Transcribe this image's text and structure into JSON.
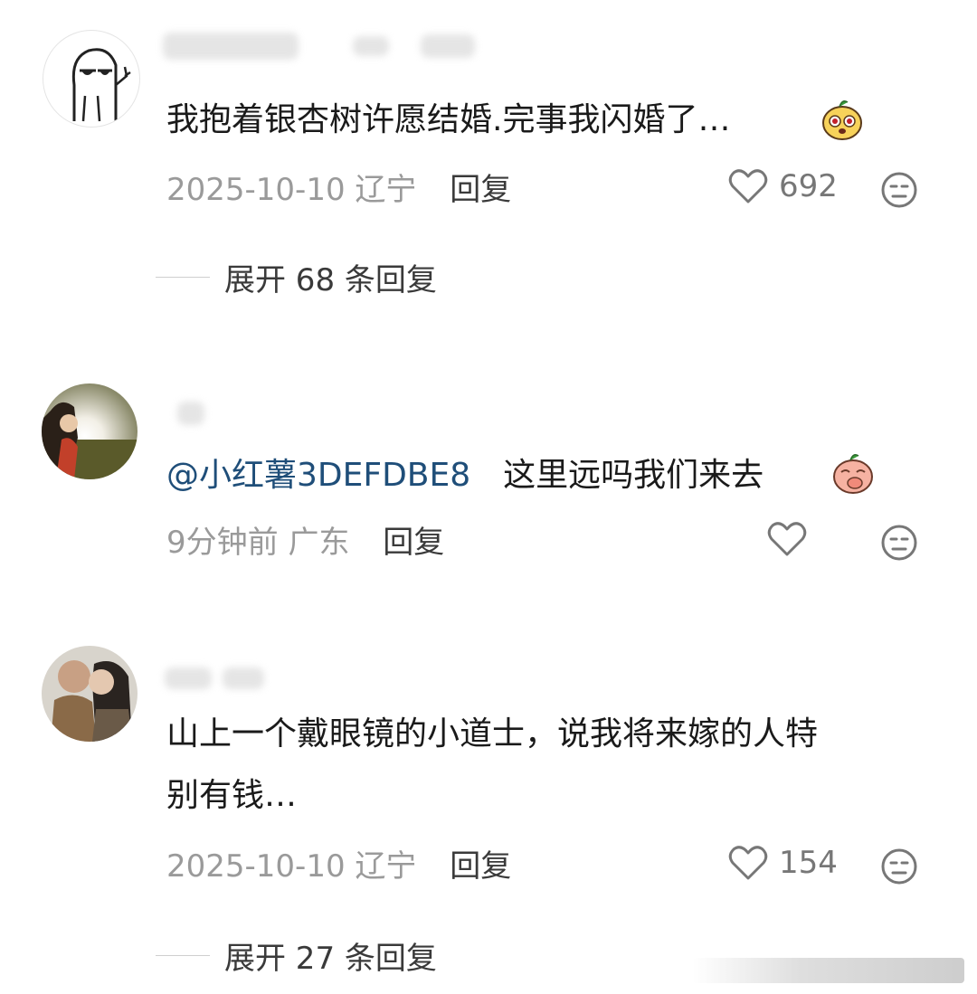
{
  "colors": {
    "mention": "#1f4e79",
    "meta_text": "#9a9a9a",
    "body_text": "#1a1a1a",
    "icon_grey": "#777777"
  },
  "comments": [
    {
      "text": "我抱着银杏树许愿结婚.完事我闪婚了…",
      "emoji": "peach-face-shocked",
      "date": "2025-10-10",
      "location": "辽宁",
      "reply_label": "回复",
      "likes": "692",
      "like_icon": "heart-outline-icon",
      "dislike_icon": "meh-face-icon"
    },
    {
      "mention": "@小红薯3DEFDBE8",
      "text": "这里远吗我们来去",
      "emoji": "peach-face-covering-mouth",
      "date": "9分钟前",
      "location": "广东",
      "reply_label": "回复",
      "likes": "",
      "like_icon": "heart-outline-icon",
      "dislike_icon": "meh-face-icon"
    },
    {
      "text_line1": "山上一个戴眼镜的小道士，说我将来嫁的人特",
      "text_line2": "别有钱…",
      "date": "2025-10-10",
      "location": "辽宁",
      "reply_label": "回复",
      "likes": "154",
      "like_icon": "heart-outline-icon",
      "dislike_icon": "meh-face-icon"
    }
  ],
  "threads": [
    {
      "label": "展开 68 条回复"
    },
    {
      "label": "展开 27 条回复"
    }
  ]
}
